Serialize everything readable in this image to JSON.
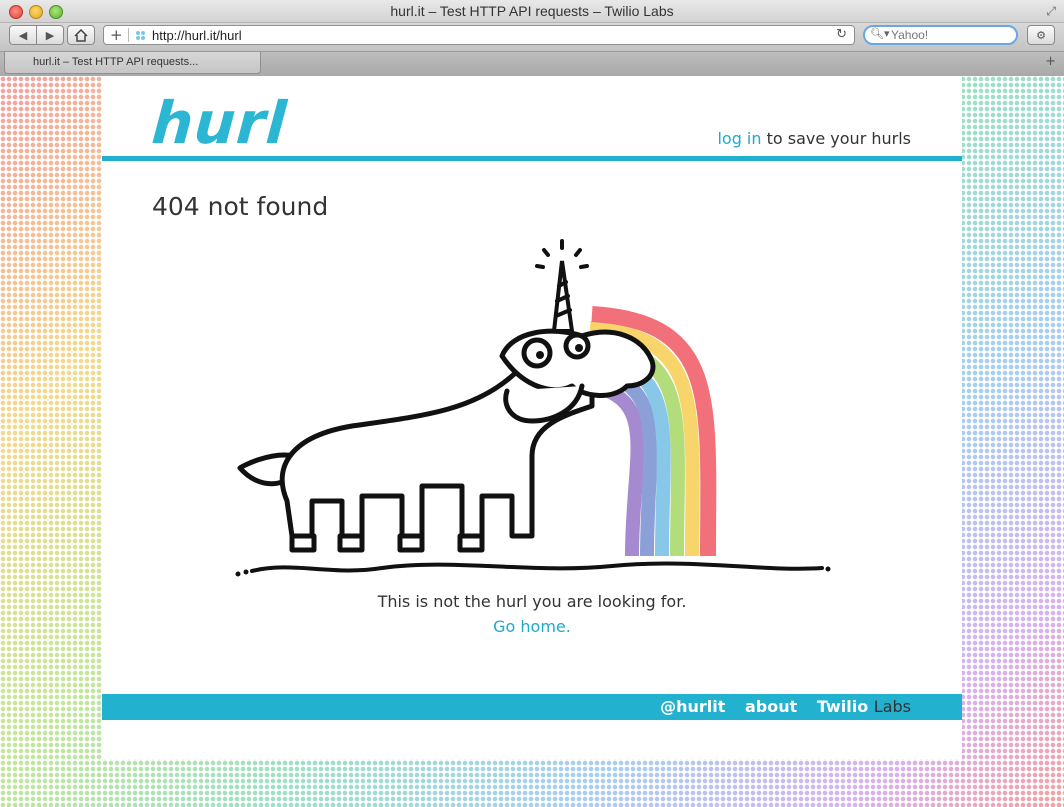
{
  "window": {
    "title": "hurl.it – Test HTTP API requests – Twilio Labs"
  },
  "toolbar": {
    "url": "http://hurl.it/hurl",
    "search_placeholder": "Yahoo!"
  },
  "tabs": [
    {
      "label": "hurl.it – Test HTTP API requests..."
    }
  ],
  "page": {
    "logo": "hurl",
    "header": {
      "login_link": "log in",
      "login_suffix": " to save your hurls"
    },
    "heading": "404 not found",
    "message": "This is not the hurl you are looking for.",
    "home_link": "Go home.",
    "footer": {
      "twitter": "@hurlit",
      "about": "about",
      "brand_twilio": "Twilio",
      "brand_labs": "Labs"
    }
  },
  "colors": {
    "accent": "#21b0cf",
    "link": "#21a9cb",
    "text": "#333333"
  },
  "illustration": {
    "subject": "unicorn-vomiting-rainbow",
    "rainbow": [
      "#f2707a",
      "#f7d56b",
      "#b3dc7a",
      "#88c7e8",
      "#8aa0d6",
      "#a58ad0"
    ]
  }
}
